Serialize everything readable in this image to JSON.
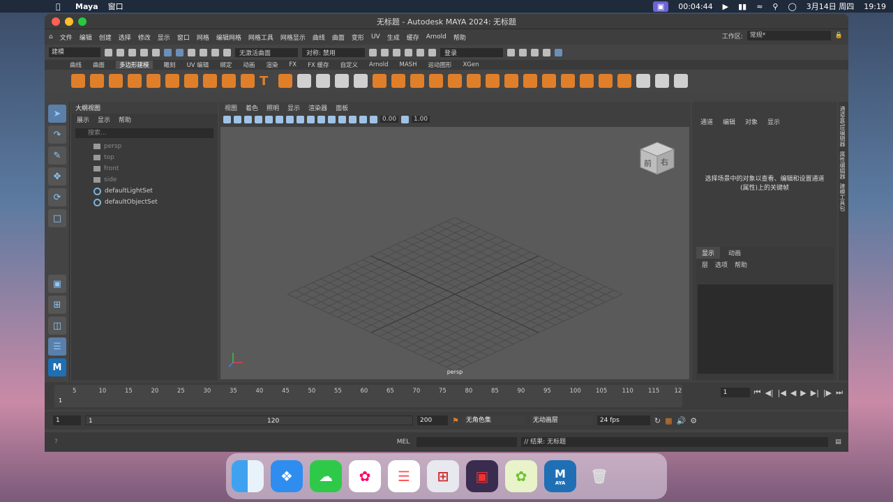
{
  "menubar": {
    "app": "Maya",
    "window": "窗口",
    "recording_time": "00:04:44",
    "date": "3月14日 周四",
    "time": "19:19"
  },
  "window": {
    "title": "无标题 - Autodesk MAYA 2024: 无标题"
  },
  "main_menu": [
    "文件",
    "编辑",
    "创建",
    "选择",
    "修改",
    "显示",
    "窗口",
    "网格",
    "编辑网格",
    "网格工具",
    "网格显示",
    "曲线",
    "曲面",
    "变形",
    "UV",
    "生成",
    "缓存",
    "Arnold",
    "帮助"
  ],
  "workspace": {
    "label": "工作区:",
    "value": "常规*"
  },
  "status_line": {
    "mode": "建模",
    "live_surface": "无激活曲面",
    "symmetry": "对称: 禁用",
    "login": "登录"
  },
  "shelf": {
    "tabs": [
      "曲线",
      "曲面",
      "多边形建模",
      "雕刻",
      "UV 编辑",
      "绑定",
      "动画",
      "渲染",
      "FX",
      "FX 缓存",
      "自定义",
      "Arnold",
      "MASH",
      "运动图形",
      "XGen"
    ],
    "active_tab": "多边形建模"
  },
  "outliner": {
    "title": "大纲视图",
    "menu": [
      "展示",
      "显示",
      "帮助"
    ],
    "search_placeholder": "搜索...",
    "items": [
      {
        "label": "persp",
        "type": "camera"
      },
      {
        "label": "top",
        "type": "camera"
      },
      {
        "label": "front",
        "type": "camera"
      },
      {
        "label": "side",
        "type": "camera"
      },
      {
        "label": "defaultLightSet",
        "type": "set"
      },
      {
        "label": "defaultObjectSet",
        "type": "set"
      }
    ]
  },
  "viewport": {
    "menu": [
      "视图",
      "着色",
      "照明",
      "显示",
      "渲染器",
      "面板"
    ],
    "value1": "0.00",
    "value2": "1.00",
    "camera_label": "persp",
    "cube_front": "前",
    "cube_right": "右"
  },
  "channel_box": {
    "menu": [
      "通道",
      "编辑",
      "对象",
      "显示"
    ],
    "message": "选择场景中的对象以查看、编辑和设置通道(属性)上的关键帧"
  },
  "layer_editor": {
    "tabs": [
      "显示",
      "动画"
    ],
    "menu": [
      "层",
      "选项",
      "帮助"
    ]
  },
  "side_tabs": [
    "通道盒/层编辑器",
    "属性编辑器",
    "建模工具包"
  ],
  "timeline": {
    "ticks": [
      "5",
      "10",
      "15",
      "20",
      "25",
      "30",
      "35",
      "40",
      "45",
      "50",
      "55",
      "60",
      "65",
      "70",
      "75",
      "80",
      "85",
      "90",
      "95",
      "100",
      "105",
      "110",
      "115",
      "12"
    ],
    "current_frame": "1",
    "frame_field": "1"
  },
  "range": {
    "start": "1",
    "playback_start": "1",
    "playback_end": "120",
    "end": "200",
    "character_set": "无角色集",
    "anim_layer": "无动画层",
    "fps": "24 fps"
  },
  "command_line": {
    "lang": "MEL",
    "result": "// 结果: 无标题"
  },
  "dock": {
    "apps": [
      "finder-icon",
      "safari-icon",
      "messages-icon",
      "photos-icon",
      "reminders-icon",
      "launchpad-icon",
      "screen-recorder-icon",
      "green-leaf-app-icon",
      "maya-icon",
      "trash-icon"
    ],
    "maya_label": "M",
    "maya_sub": "AYA"
  }
}
